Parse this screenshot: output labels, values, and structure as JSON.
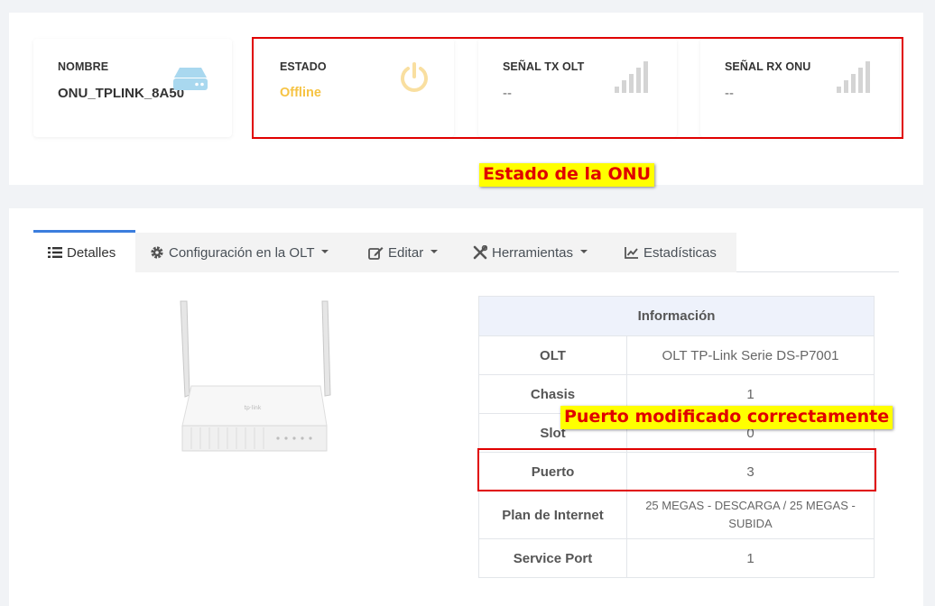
{
  "status_cards": [
    {
      "label": "NOMBRE",
      "value": "ONU_TPLINK_8A50",
      "icon": "router-icon"
    },
    {
      "label": "ESTADO",
      "value": "Offline",
      "icon": "power-icon"
    },
    {
      "label": "SEÑAL TX OLT",
      "value": "--",
      "icon": "signal-bars-icon"
    },
    {
      "label": "SEÑAL RX ONU",
      "value": "--",
      "icon": "signal-bars-icon"
    }
  ],
  "annotations": {
    "estado": "Estado de la ONU",
    "puerto": "Puerto modificado correctamente"
  },
  "tabs": [
    {
      "label": "Detalles",
      "icon": "list-icon",
      "active": true
    },
    {
      "label": "Configuración en la OLT",
      "icon": "gear-icon",
      "dropdown": true
    },
    {
      "label": "Editar",
      "icon": "edit-icon",
      "dropdown": true
    },
    {
      "label": "Herramientas",
      "icon": "tools-icon",
      "dropdown": true
    },
    {
      "label": "Estadísticas",
      "icon": "chart-line-icon"
    }
  ],
  "info_table": {
    "header": "Información",
    "rows": [
      {
        "key": "OLT",
        "value": "OLT TP-Link Serie DS-P7001"
      },
      {
        "key": "Chasis",
        "value": "1"
      },
      {
        "key": "Slot",
        "value": "0"
      },
      {
        "key": "Puerto",
        "value": "3"
      },
      {
        "key": "Plan de Internet",
        "value": "25 MEGAS - DESCARGA / 25 MEGAS - SUBIDA"
      },
      {
        "key": "Service Port",
        "value": "1"
      }
    ]
  },
  "colors": {
    "offline": "#f6c343",
    "tab_active": "#3b7ddd",
    "highlight": "#e00000",
    "note_bg": "#ffff00"
  }
}
